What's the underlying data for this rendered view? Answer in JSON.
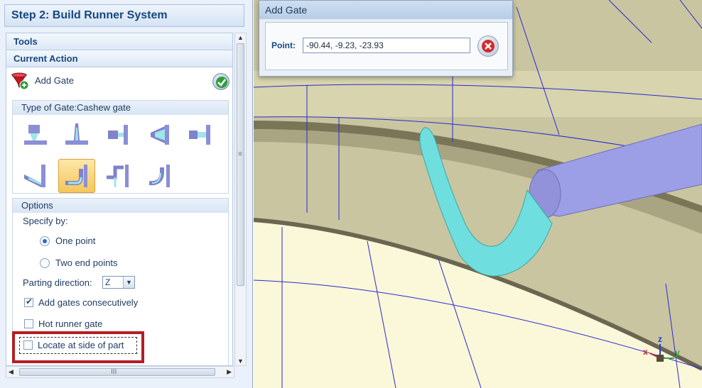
{
  "panel": {
    "title": "Step 2: Build Runner System",
    "tools_label": "Tools",
    "current_action_label": "Current Action",
    "action_label": "Add Gate",
    "gate_type_label": "Type of Gate:Cashew gate",
    "options": {
      "title": "Options",
      "specify_by_label": "Specify by:",
      "one_point_label": "One point",
      "two_end_points_label": "Two end points",
      "parting_direction_label": "Parting direction:",
      "parting_direction_value": "Z",
      "add_consecutively_label": "Add gates consecutively",
      "hot_runner_label": "Hot runner gate",
      "locate_side_label": "Locate at side of part"
    },
    "scroll_grip": "III"
  },
  "dialog": {
    "title": "Add Gate",
    "point_label": "Point:",
    "point_value": "-90.44, -9.23, -23.93"
  },
  "axes": {
    "z": "z",
    "x": "x",
    "y": "y"
  },
  "colors": {
    "accent": "#16477e",
    "highlight_border": "#b51d23",
    "selected_gate": "#f6c659",
    "cashew_gate": "#6fdede",
    "runner": "#9c9ee6",
    "model_wall": "#c9c5a0",
    "model_edge": "#2a2ad0"
  }
}
